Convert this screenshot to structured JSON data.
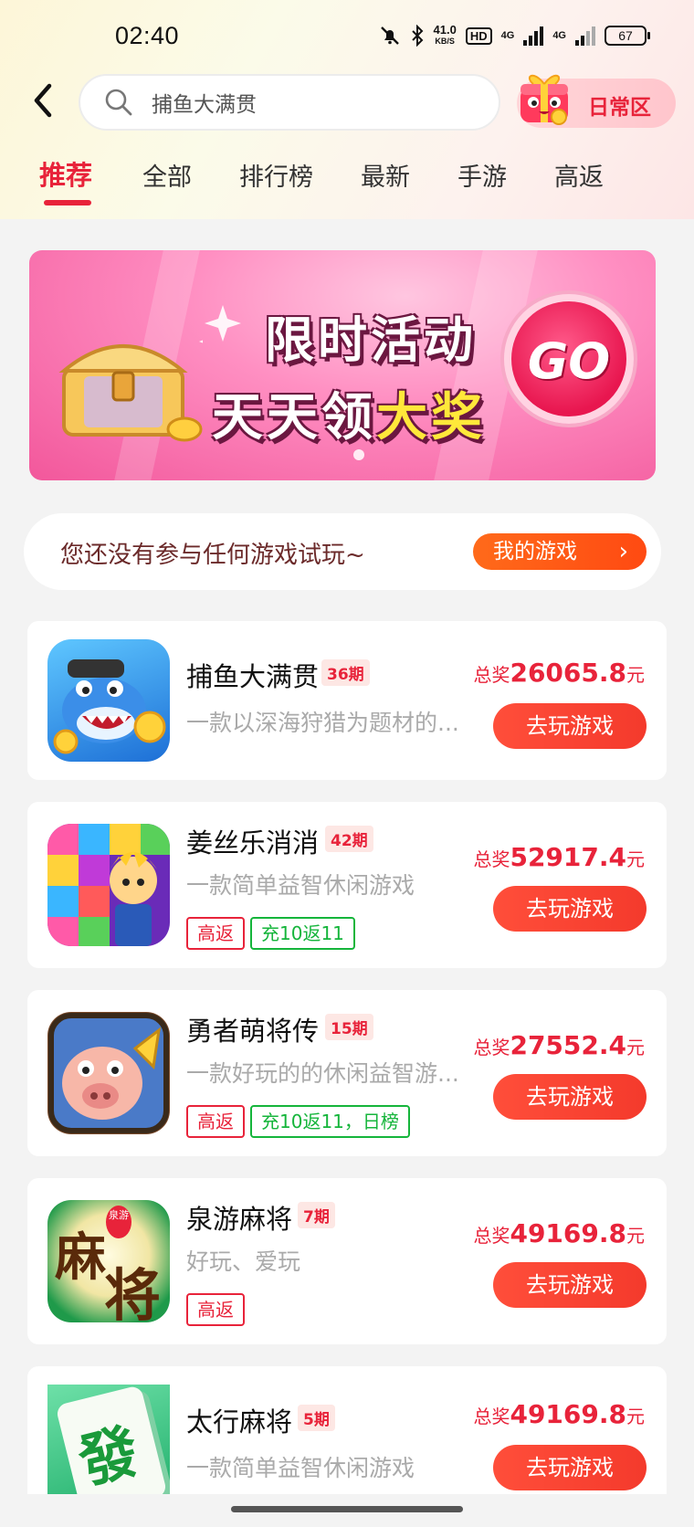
{
  "status_bar": {
    "time": "02:40",
    "speed_value": "41.0",
    "speed_unit": "KB/S",
    "hd": "HD",
    "network1": "4G",
    "network2": "4G",
    "battery": "67",
    "icons": [
      "mute-bell-icon",
      "bluetooth-icon",
      "signal-icon",
      "battery-icon"
    ]
  },
  "header": {
    "search_query": "捕鱼大满贯",
    "daily_zone_label": "日常区"
  },
  "tabs": [
    {
      "label": "推荐",
      "active": true
    },
    {
      "label": "全部"
    },
    {
      "label": "排行榜"
    },
    {
      "label": "最新"
    },
    {
      "label": "手游"
    },
    {
      "label": "高返"
    }
  ],
  "banner": {
    "line1": "限时活动",
    "line2_a": "天天领",
    "line2_b": "大奖",
    "go_label": "GO"
  },
  "notice": {
    "text": "您还没有参与任何游戏试玩~",
    "button": "我的游戏"
  },
  "games": [
    {
      "name": "捕鱼大满贯",
      "period": "36期",
      "desc": "一款以深海狩猎为题材的...",
      "prize_label": "总奖",
      "prize_value": "26065.8",
      "prize_unit": "元",
      "play": "去玩游戏",
      "tags": []
    },
    {
      "name": "姜丝乐消消",
      "period": "42期",
      "desc": "一款简单益智休闲游戏",
      "prize_label": "总奖",
      "prize_value": "52917.4",
      "prize_unit": "元",
      "play": "去玩游戏",
      "tags": [
        "高返",
        "充10返11"
      ]
    },
    {
      "name": "勇者萌将传",
      "period": "15期",
      "desc": "一款好玩的的休闲益智游...",
      "prize_label": "总奖",
      "prize_value": "27552.4",
      "prize_unit": "元",
      "play": "去玩游戏",
      "tags": [
        "高返",
        "充10返11，日榜"
      ]
    },
    {
      "name": "泉游麻将",
      "period": "7期",
      "desc": "好玩、爱玩",
      "prize_label": "总奖",
      "prize_value": "49169.8",
      "prize_unit": "元",
      "play": "去玩游戏",
      "tags": [
        "高返"
      ],
      "icon_text_a": "麻",
      "icon_text_b": "将",
      "icon_badge": "泉游"
    },
    {
      "name": "太行麻将",
      "period": "5期",
      "desc": "一款简单益智休闲游戏",
      "prize_label": "总奖",
      "prize_value": "49169.8",
      "prize_unit": "元",
      "play": "去玩游戏",
      "tags": [],
      "icon_text": "發"
    }
  ]
}
